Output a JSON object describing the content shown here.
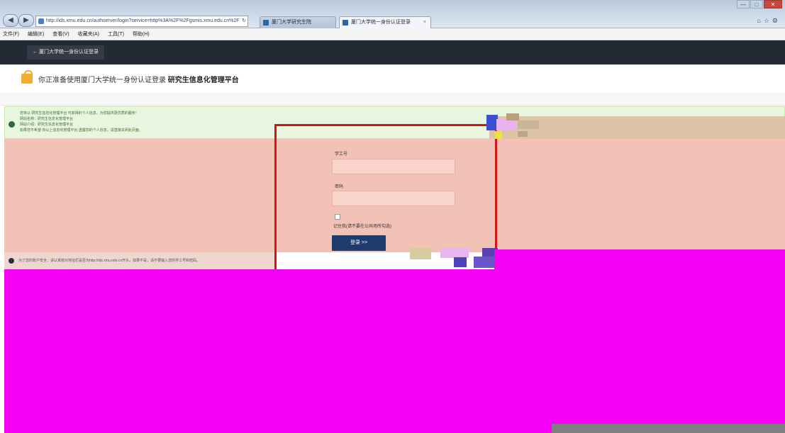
{
  "browser": {
    "address_url": "http://ids.xmu.edu.cn/authserver/login?service=http%3A%2F%2Fgsmis.xmu.edu.cn%2F",
    "address_domain": "xmu.edu.cn",
    "tabs": [
      {
        "label": "厦门大学研究生院",
        "active": false
      },
      {
        "label": "厦门大学统一身份认证登录",
        "active": true
      }
    ],
    "menu": [
      "文件(F)",
      "编辑(E)",
      "查看(V)",
      "收藏夹(A)",
      "工具(T)",
      "帮助(H)"
    ]
  },
  "header": {
    "back_link": "厦门大学统一身份认证登录"
  },
  "notice": {
    "prefix": "你正准备使用厦门大学统一身份认证登录",
    "system": "研究生信息化管理平台"
  },
  "success_box": {
    "lines": [
      "您将以 研究生信息化管理平台 可获得的个人信息，为您提供更优质的服务！",
      "网站名称：研究生信息化管理平台",
      "网站介绍：研究生信息化管理平台",
      "如果您不希望 向以上信息化管理平台 透露您的个人信息，请直接关闭此页面。"
    ]
  },
  "form": {
    "username_label": "学工号",
    "password_label": "密码",
    "remember_label": "记住我(请不要在公共场所勾选)",
    "login_button": "登录 >>"
  },
  "footer": {
    "security_note": "为了您的账户安全，请认真核对地址栏是否为http://ids.xmu.edu.cn开头，如果不是，请不要输入您的学工号和密码。"
  },
  "colors": {
    "dark_header": "#242a33",
    "login_button": "#1e3b6d",
    "focus_frame": "#d21616",
    "overlay_magenta": "#f500f5",
    "overlay_salmon": "#f3c2b7"
  }
}
